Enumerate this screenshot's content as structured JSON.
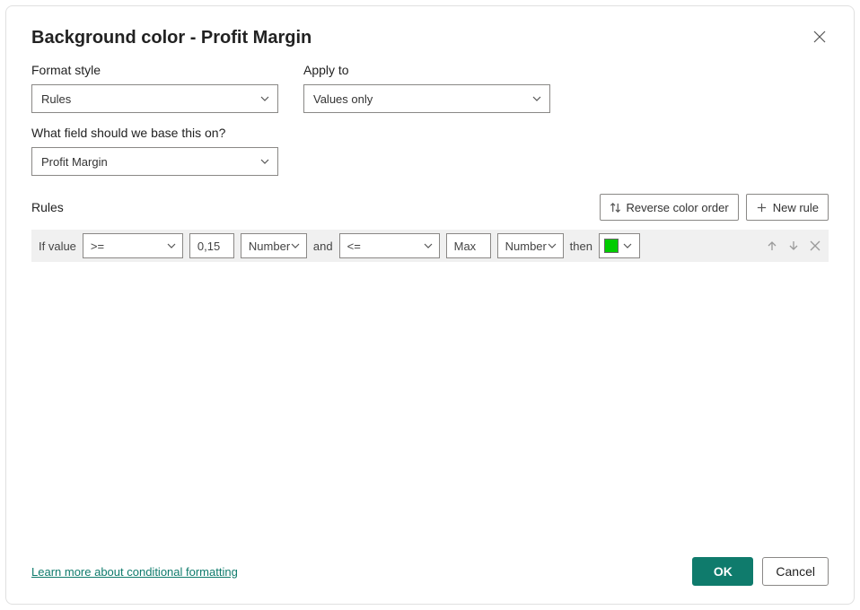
{
  "dialog": {
    "title": "Background color - Profit Margin"
  },
  "form": {
    "format_style": {
      "label": "Format style",
      "value": "Rules"
    },
    "apply_to": {
      "label": "Apply to",
      "value": "Values only"
    },
    "base_field": {
      "label": "What field should we base this on?",
      "value": "Profit Margin"
    }
  },
  "rules": {
    "section_label": "Rules",
    "reverse_label": "Reverse color order",
    "new_rule_label": "New rule",
    "rows": [
      {
        "if_label": "If value",
        "op1": ">=",
        "val1": "0,15",
        "type1": "Number",
        "and_label": "and",
        "op2": "<=",
        "val2": "Max",
        "type2": "Number",
        "then_label": "then",
        "color": "#00cc00"
      }
    ]
  },
  "footer": {
    "learn_more": "Learn more about conditional formatting",
    "ok": "OK",
    "cancel": "Cancel"
  }
}
